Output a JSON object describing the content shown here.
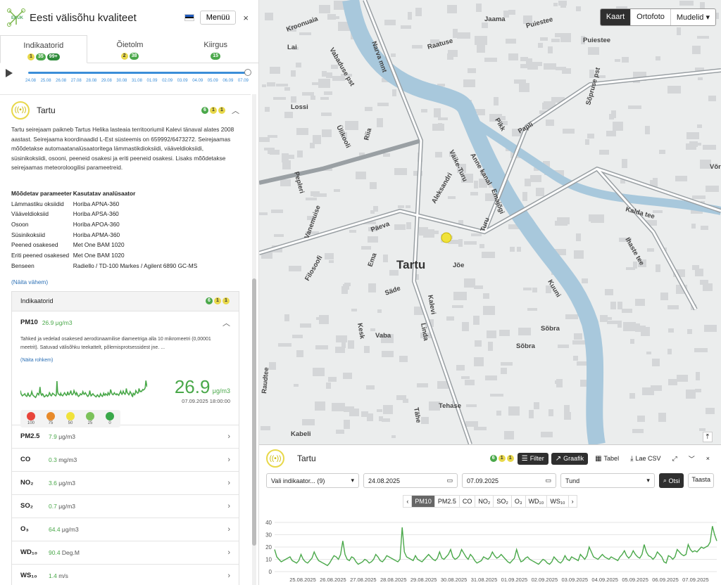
{
  "app": {
    "logo_text": "EKUK",
    "title": "Eesti välisõhu kvaliteet",
    "menu_label": "Menüü",
    "close": "×"
  },
  "tabs": [
    {
      "label": "Indikaatorid",
      "badges": [
        "1",
        "35",
        "99+"
      ],
      "active": true
    },
    {
      "label": "Õietolm",
      "badges": [
        "2",
        "38"
      ],
      "active": false
    },
    {
      "label": "Kiirgus",
      "badges": [
        "15"
      ],
      "active": false
    }
  ],
  "timeline": {
    "ticks": [
      "24.08",
      "25.08",
      "26.08",
      "27.08",
      "28.08",
      "29.08",
      "30.08",
      "31.08",
      "01.09",
      "02.09",
      "03.09",
      "04.09",
      "05.09",
      "06.09",
      "07.09"
    ],
    "progress": 1.0
  },
  "station": {
    "name": "Tartu",
    "badges": [
      "6",
      "1",
      "1"
    ],
    "description": "Tartu seirejaam paikneb Tartus Helika lasteaia territooriumil Kalevi tänaval alates 2008 aastast. Seirejaama koordinaadid L-Est süsteemis on 659992/6473272. Seirejaamas mõõdetakse automaatanalüsaatoritega lämmastikdioksiidi, vääveldioksiidi, süsinikoksiidi, osooni, peeneid osakesi ja eriti peeneid osakesi. Lisaks mõõdetakse seirejaamas meteoroloogilisi parameetreid.",
    "params_header": [
      "Mõõdetav parameeter",
      "Kasutatav analüsaator"
    ],
    "params": [
      [
        "Lämmastiku oksiidid",
        "Horiba APNA-360"
      ],
      [
        "Vääveldioksiid",
        "Horiba APSA-360"
      ],
      [
        "Osoon",
        "Horiba APOA-360"
      ],
      [
        "Süsinikoksiid",
        "Horiba APMA-360"
      ],
      [
        "Peened osakesed",
        "Met One BAM 1020"
      ],
      [
        "Eriti peened osakesed",
        "Met One BAM 1020"
      ],
      [
        "Benseen",
        "Radiello / TD-100 Markes / Agilent 6890 GC-MS"
      ]
    ],
    "show_less": "(Näita vähem)"
  },
  "indicators": {
    "title": "Indikaatorid",
    "badges": [
      "6",
      "1",
      "1"
    ],
    "pm10": {
      "name": "PM10",
      "value": "26.9",
      "unit": "μg/m3",
      "description": "Tahked ja vedelad osakesed aerodünaamilise diameetriga alla 10 mikromeetri (0,00001 meetrit). Satuvad välisõhku teekattelt, põlemisprotsessidest jne. ...",
      "show_more": "(Näita rohkem)",
      "big_value": "26.9",
      "big_unit": "μg/m3",
      "timestamp": "07.09.2025 18:00:00",
      "scale": [
        {
          "label": "100",
          "color": "#e8443a"
        },
        {
          "label": "75",
          "color": "#e88a2a"
        },
        {
          "label": "50",
          "color": "#f0e23a"
        },
        {
          "label": "25",
          "color": "#7cc25a"
        },
        {
          "label": "0",
          "color": "#3aa84a"
        }
      ]
    },
    "rows": [
      {
        "name": "PM2.5",
        "value": "7.9",
        "unit": "μg/m3"
      },
      {
        "name": "CO",
        "value": "0.3",
        "unit": "mg/m3"
      },
      {
        "name": "NO₂",
        "value": "3.6",
        "unit": "μg/m3"
      },
      {
        "name": "SO₂",
        "value": "0.7",
        "unit": "μg/m3"
      },
      {
        "name": "O₃",
        "value": "64.4",
        "unit": "μg/m3"
      },
      {
        "name": "WD₁₀",
        "value": "90.4",
        "unit": "Deg.M"
      },
      {
        "name": "WS₁₀",
        "value": "1.4",
        "unit": "m/s"
      }
    ]
  },
  "map": {
    "controls": [
      "Kaart",
      "Ortofoto",
      "Mudelid ▾"
    ],
    "city_label": "Tartu",
    "streets": [
      "Narva mnt",
      "Vabaduse pst",
      "Riia",
      "Kalevi",
      "Emajõgi",
      "Anne kanal",
      "Turu",
      "Jaama",
      "Puiestee",
      "Raatuse",
      "Kalda tee",
      "Ihaste tee",
      "Sõpruse pst",
      "Võru",
      "Vaba",
      "Tähe",
      "Sõbra",
      "Tehase",
      "Kabeli",
      "Pikk",
      "Lai",
      "Lossi",
      "Pepleri",
      "Vanemuise",
      "Aleksandri",
      "Päeva",
      "Säde",
      "Kroonuaia",
      "Papli",
      "Jõe",
      "Ülikooli",
      "Kuuni",
      "Väike-Turu",
      "Raudtee",
      "Filosoofi",
      "Ema",
      "Kesk",
      "Linda",
      "Sõbra",
      "Puiestee"
    ]
  },
  "bottom": {
    "station_name": "Tartu",
    "badges": [
      "6",
      "1",
      "1"
    ],
    "buttons": {
      "filter": "Filter",
      "graafik": "Graafik",
      "tabel": "Tabel",
      "csv": "Lae CSV"
    },
    "filters": {
      "indicator": "Vali indikaator... (9)",
      "date_from": "24.08.2025",
      "date_to": "07.09.2025",
      "interval": "Tund",
      "search": "Otsi",
      "reset": "Taasta"
    },
    "param_tabs": [
      "PM10",
      "PM2.5",
      "CO",
      "NO₂",
      "SO₂",
      "O₃",
      "WD₁₀",
      "WS₁₀"
    ],
    "active_param": "PM10"
  },
  "chart_data": {
    "type": "line",
    "title": "",
    "xlabel": "",
    "ylabel": "",
    "x_ticks": [
      "25.08.2025",
      "26.08.2025",
      "27.08.2025",
      "28.08.2025",
      "29.08.2025",
      "30.08.2025",
      "31.08.2025",
      "01.09.2025",
      "02.09.2025",
      "03.09.2025",
      "04.09.2025",
      "05.09.2025",
      "06.09.2025",
      "07.09.2025"
    ],
    "y_ticks": [
      0,
      10,
      20,
      30,
      40
    ],
    "ylim": [
      0,
      40
    ],
    "grid": true,
    "color": "#4aa84a",
    "series": [
      {
        "values": [
          18,
          12,
          10,
          8,
          9,
          10,
          11,
          12,
          9,
          8,
          7,
          9,
          14,
          10,
          8,
          7,
          9,
          11,
          16,
          12,
          9,
          8,
          7,
          6,
          5,
          7,
          10,
          13,
          12,
          10,
          14,
          25,
          14,
          10,
          9,
          12,
          11,
          8,
          6,
          7,
          8,
          10,
          9,
          7,
          8,
          10,
          14,
          12,
          9,
          8,
          10,
          13,
          12,
          11,
          10,
          9,
          8,
          10,
          36,
          16,
          12,
          11,
          10,
          9,
          13,
          10,
          9,
          8,
          10,
          12,
          14,
          12,
          10,
          9,
          11,
          16,
          11,
          10,
          12,
          14,
          18,
          12,
          10,
          11,
          13,
          18,
          15,
          12,
          10,
          14,
          12,
          9,
          7,
          8,
          9,
          12,
          11,
          10,
          12,
          16,
          13,
          11,
          12,
          14,
          12,
          10,
          8,
          7,
          9,
          11,
          18,
          12,
          8,
          9,
          11,
          12,
          10,
          9,
          8,
          7,
          6,
          8,
          10,
          9,
          7,
          6,
          8,
          12,
          10,
          8,
          7,
          9,
          13,
          10,
          9,
          12,
          11,
          10,
          9,
          14,
          12,
          10,
          13,
          20,
          16,
          12,
          11,
          10,
          12,
          14,
          12,
          11,
          10,
          12,
          11,
          10,
          9,
          12,
          14,
          17,
          13,
          11,
          13,
          17,
          14,
          12,
          11,
          14,
          22,
          16,
          13,
          12,
          10,
          12,
          16,
          14,
          12,
          8,
          7,
          13,
          12,
          10,
          12,
          18,
          16,
          14,
          13,
          14,
          22,
          18,
          16,
          17,
          16,
          18,
          20,
          19,
          20,
          21,
          24,
          37,
          30,
          25
        ]
      }
    ]
  }
}
